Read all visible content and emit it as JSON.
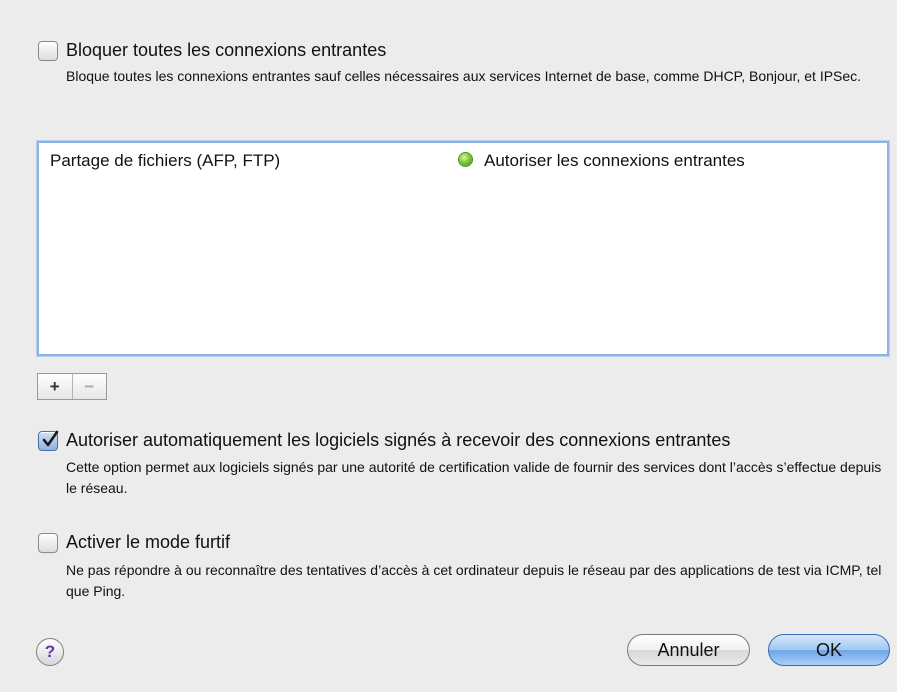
{
  "block_all": {
    "label": "Bloquer toutes les connexions entrantes",
    "checked": false,
    "description": "Bloque toutes les connexions entrantes sauf celles nécessaires aux services Internet de base, comme DHCP, Bonjour, et IPSec."
  },
  "services_list": {
    "rows": [
      {
        "name": "Partage de fichiers (AFP, FTP)",
        "status": "Autoriser les connexions entrantes",
        "status_color": "#6cc02f"
      }
    ]
  },
  "list_controls": {
    "add": "+",
    "remove": "−"
  },
  "allow_signed": {
    "label": "Autoriser automatiquement les logiciels signés à recevoir des connexions entrantes",
    "checked": true,
    "description": "Cette option permet aux logiciels signés par une autorité de certification valide de fournir des services dont l’accès s’effectue depuis le réseau."
  },
  "stealth_mode": {
    "label": "Activer le mode furtif",
    "checked": false,
    "description": "Ne pas répondre à ou reconnaître des tentatives d’accès à cet ordinateur depuis le réseau par des applications de test via ICMP, tel que Ping."
  },
  "footer": {
    "help": "?",
    "cancel": "Annuler",
    "ok": "OK"
  },
  "colors": {
    "accent": "#8eb3e6",
    "default_button": "#6fa5e5"
  }
}
